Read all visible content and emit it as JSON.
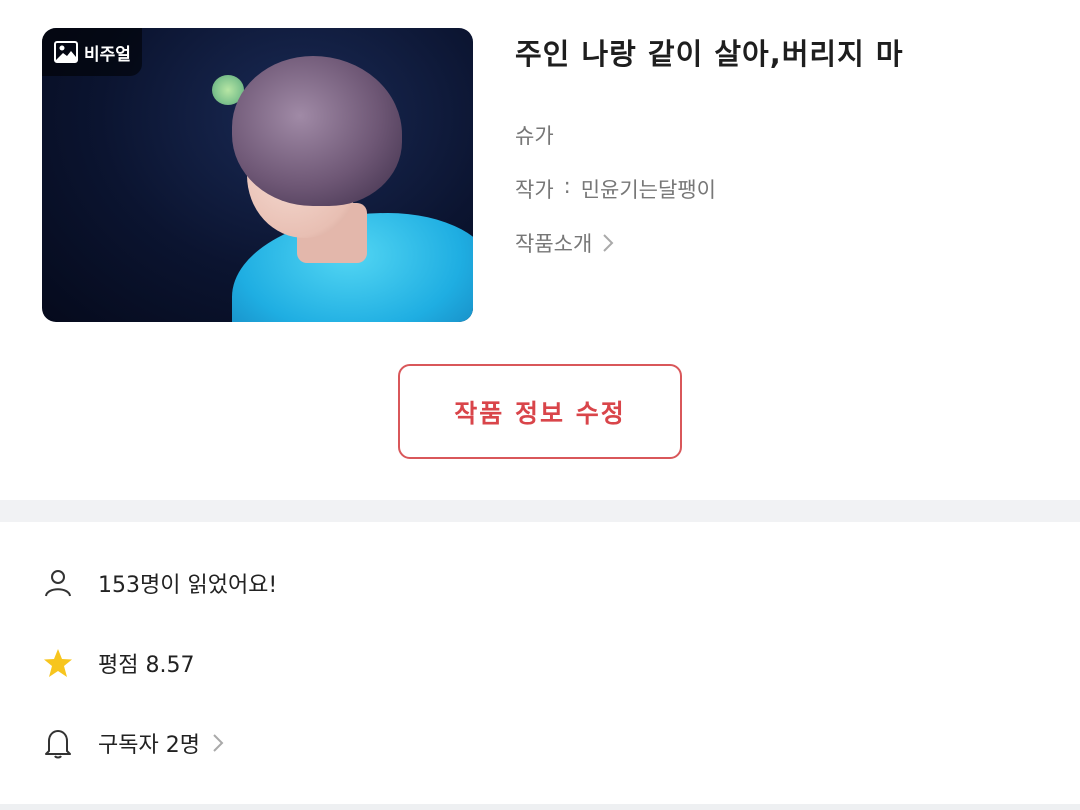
{
  "cover": {
    "badge_label": "비주얼",
    "badge_icon": "image-icon"
  },
  "work": {
    "title": "주인 나랑 같이 살아,버리지 마",
    "genre": "슈가",
    "author_label": "작가",
    "author_sep": ":",
    "author_name": "민윤기는달팽이",
    "intro_label": "작품소개"
  },
  "edit_button_label": "작품 정보 수정",
  "stats": {
    "readers_text": "153명이 읽었어요!",
    "rating_text": "평점 8.57",
    "subscribers_text": "구독자 2명"
  },
  "colors": {
    "accent": "#d9575a",
    "star": "#f7c51e",
    "muted_text": "#777777",
    "divider": "#f1f2f4"
  },
  "icons": {
    "readers": "person-icon",
    "rating": "star-icon",
    "subscribers": "bell-icon",
    "chevron": "chevron-right-icon"
  }
}
